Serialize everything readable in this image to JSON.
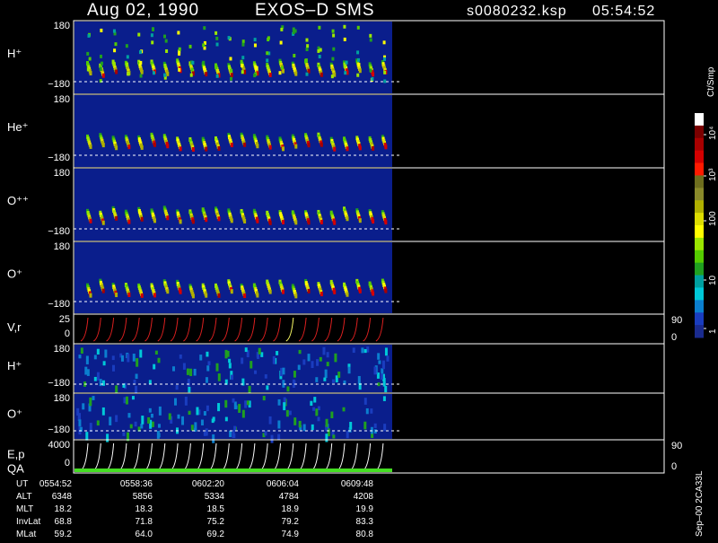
{
  "header": {
    "date": "Aug 02, 1990",
    "instrument": "EXOS–D SMS",
    "file": "s0080232.ksp",
    "time": "05:54:52"
  },
  "colorbar": {
    "unit": "Ct/Smp",
    "labels": [
      "10⁴",
      "10³",
      "100",
      "10",
      "1"
    ],
    "colors": [
      "#ffffff",
      "#7a0000",
      "#a80000",
      "#d40000",
      "#ff1a00",
      "#6e6e1e",
      "#8a8a2a",
      "#b0b000",
      "#dddd00",
      "#ffff00",
      "#9be600",
      "#55cc00",
      "#20a020",
      "#00a0a0",
      "#00c8d8",
      "#0b7fcf",
      "#1a3dbf",
      "#1a2b8f"
    ]
  },
  "panels": [
    {
      "id": "hplus",
      "label": "H⁺",
      "ymax": "180",
      "ymin": "−180"
    },
    {
      "id": "heplus",
      "label": "He⁺",
      "ymax": "180",
      "ymin": "−180"
    },
    {
      "id": "oplusplus",
      "label": "O⁺⁺",
      "ymax": "180",
      "ymin": "−180"
    },
    {
      "id": "oplus",
      "label": "O⁺",
      "ymax": "180",
      "ymin": "−180"
    },
    {
      "id": "vr",
      "label": "V,r",
      "ymax": "25",
      "ymin": "0",
      "rmax": "90",
      "rmin": "0"
    },
    {
      "id": "hplus2",
      "label": "H⁺",
      "ymax": "180",
      "ymin": "−180"
    },
    {
      "id": "oplus2",
      "label": "O⁺",
      "ymax": "180",
      "ymin": "−180"
    },
    {
      "id": "ep",
      "label": "E,p",
      "label2": "QA",
      "ymax": "4000",
      "ymin": "0",
      "rmax": "90",
      "rmin": "0"
    }
  ],
  "ephemeris": {
    "rows": [
      {
        "name": "UT",
        "values": [
          "0554:52",
          "0558:36",
          "0602:20",
          "0606:04",
          "0609:48"
        ]
      },
      {
        "name": "ALT",
        "values": [
          "6348",
          "5856",
          "5334",
          "4784",
          "4208"
        ]
      },
      {
        "name": "MLT",
        "values": [
          "18.2",
          "18.3",
          "18.5",
          "18.9",
          "19.9"
        ]
      },
      {
        "name": "InvLat",
        "values": [
          "68.8",
          "71.8",
          "75.2",
          "79.2",
          "83.3"
        ]
      },
      {
        "name": "MLat",
        "values": [
          "59.2",
          "64.0",
          "69.2",
          "74.9",
          "80.8"
        ]
      }
    ]
  },
  "footer": {
    "code": "Sep–00 2CA33L"
  },
  "chart_data": {
    "type": "heatmap",
    "title": "Aug 02, 1990   EXOS–D SMS",
    "xlabel": "UT",
    "x_ticks": [
      "0554:52",
      "0558:36",
      "0602:20",
      "0606:04",
      "0609:48"
    ],
    "series": [
      {
        "name": "H⁺",
        "ylim": [
          -180,
          180
        ]
      },
      {
        "name": "He⁺",
        "ylim": [
          -180,
          180
        ]
      },
      {
        "name": "O⁺⁺",
        "ylim": [
          -180,
          180
        ]
      },
      {
        "name": "O⁺",
        "ylim": [
          -180,
          180
        ]
      },
      {
        "name": "V,r",
        "ylim": [
          0,
          25
        ],
        "y2lim": [
          0,
          90
        ]
      },
      {
        "name": "H⁺",
        "ylim": [
          -180,
          180
        ]
      },
      {
        "name": "O⁺",
        "ylim": [
          -180,
          180
        ]
      },
      {
        "name": "E,p",
        "ylim": [
          0,
          4000
        ],
        "y2lim": [
          0,
          90
        ]
      }
    ],
    "colorbar": {
      "unit": "Ct/Smp",
      "ticks": [
        "1",
        "10",
        "100",
        "10³",
        "10⁴"
      ],
      "scale": "log"
    }
  }
}
